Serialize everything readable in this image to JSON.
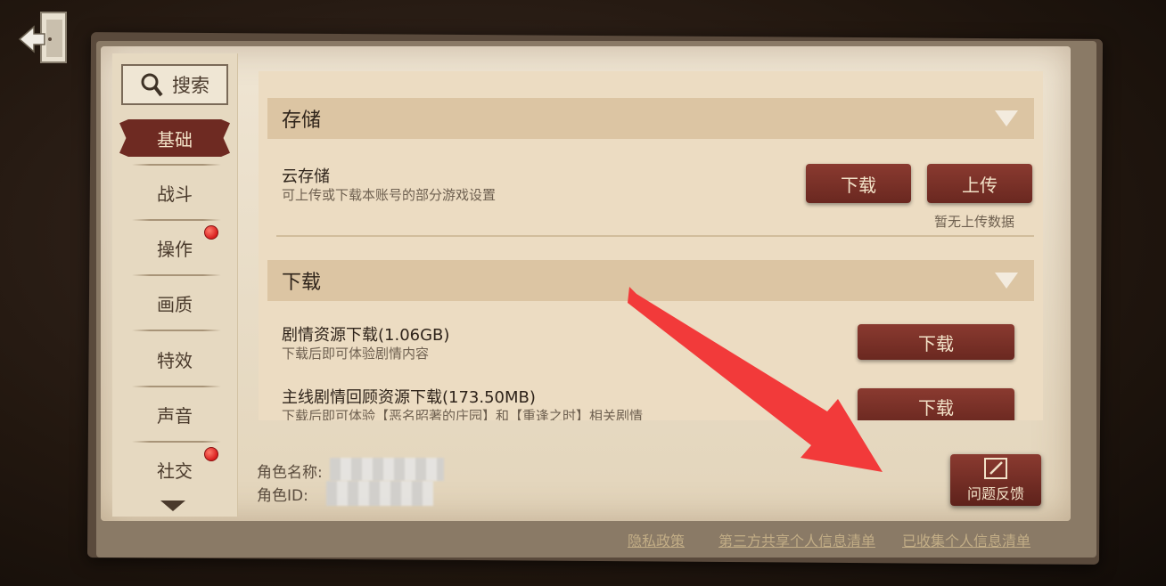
{
  "search": {
    "label": "搜索"
  },
  "sidebar": {
    "items": [
      {
        "label": "基础",
        "active": true,
        "badge": false
      },
      {
        "label": "战斗",
        "active": false,
        "badge": false
      },
      {
        "label": "操作",
        "active": false,
        "badge": true
      },
      {
        "label": "画质",
        "active": false,
        "badge": false
      },
      {
        "label": "特效",
        "active": false,
        "badge": false
      },
      {
        "label": "声音",
        "active": false,
        "badge": false
      },
      {
        "label": "社交",
        "active": false,
        "badge": true
      }
    ]
  },
  "storage": {
    "header": "存储",
    "cloud_title": "云存储",
    "cloud_desc": "可上传或下载本账号的部分游戏设置",
    "download_label": "下载",
    "upload_label": "上传",
    "upload_status": "暂无上传数据"
  },
  "download_section": {
    "header": "下载",
    "rows": [
      {
        "title": "剧情资源下载(1.06GB)",
        "desc": "下载后即可体验剧情内容",
        "button": "下载"
      },
      {
        "title": "主线剧情回顾资源下载(173.50MB)",
        "desc": "下载后即可体验【恶名昭著的庄园】和【重逢之时】相关剧情",
        "button": "下载"
      }
    ]
  },
  "role": {
    "name_label": "角色名称:",
    "id_label": "角色ID:"
  },
  "feedback": {
    "label": "问题反馈"
  },
  "footer": {
    "privacy": "隐私政策",
    "third_party": "第三方共享个人信息清单",
    "collected": "已收集个人信息清单"
  },
  "colors": {
    "accent_red": "#6e2a22",
    "parchment": "#ecdcc2",
    "annotation_arrow": "#f23a3a"
  }
}
